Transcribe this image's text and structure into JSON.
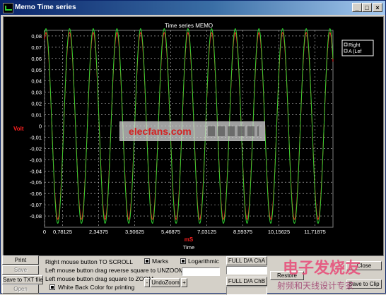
{
  "window": {
    "title": "Memo Time series",
    "minimize_icon": "minimize-icon",
    "maximize_icon": "maximize-icon",
    "close_icon": "close-icon"
  },
  "chart_data": {
    "type": "line",
    "title": "Time series MEMO",
    "xlabel": "Time",
    "xunit": "mS",
    "ylabel": "Volt",
    "xlim": [
      0,
      12.5
    ],
    "ylim": [
      -0.09,
      0.085
    ],
    "x_ticks": [
      "0",
      "0,78125",
      "2,34375",
      "3,90625",
      "5,46875",
      "7,03125",
      "8,59375",
      "10,15625",
      "11,71875"
    ],
    "y_ticks": [
      "0,08",
      "0,07",
      "0,06",
      "0,05",
      "0,04",
      "0,03",
      "0,02",
      "0,01",
      "0",
      "-0,01",
      "-0,02",
      "-0,03",
      "-0,04",
      "-0,05",
      "-0,06",
      "-0,07",
      "-0,08"
    ],
    "grid": true,
    "legend_position": "top-right",
    "series": [
      {
        "name": "",
        "color": "#ff2020",
        "amplitude": 0.083,
        "period_ms": 1.0256,
        "phase_rad": 1.2
      },
      {
        "name": "",
        "color": "#30d030",
        "amplitude": 0.0865,
        "period_ms": 1.0256,
        "phase_rad": 1.2
      }
    ],
    "background": "#000000",
    "grid_color": "#c8c8c8"
  },
  "legend": {
    "entries": [
      "Right",
      "A (Lef"
    ]
  },
  "overlay": {
    "logo_text": "elecfans.com"
  },
  "brand_watermark": {
    "top": "电子发烧友",
    "bottom": "射频和天线设计专家"
  },
  "controls": {
    "print": "Print",
    "save": "Save",
    "save_txt": "Save to TXT file",
    "open": "Open",
    "hint_scroll": "Right mouse button TO SCROLL",
    "hint_unzoom": "Left mouse button drag reverse square to UNZOOM",
    "hint_zoom": "Left mouse button drag square to ZOOM",
    "white_back": "White Back Color for printing",
    "marks": "Marks",
    "logarithmic": "Logarithmic",
    "undo_zoom": "UndoZoom",
    "minus": "-",
    "plus": "+",
    "full_da_a": "FULL D/A ChA",
    "full_da_b": "FULL D/A ChB",
    "restore": "Restore",
    "close": "Close",
    "save_to_clip": "Save to Clip"
  },
  "colors": {
    "accent": "#0a246a",
    "ch_a": "#30d030",
    "ch_b": "#ff2020",
    "volt_label": "#ff2020",
    "unit_label": "#ff2020"
  }
}
